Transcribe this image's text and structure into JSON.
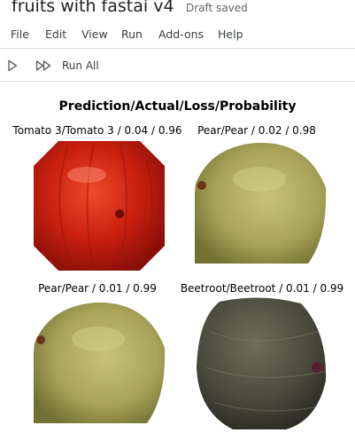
{
  "notebook": {
    "title": "fruits with fastai v4",
    "save_status": "Draft saved"
  },
  "menu": {
    "items": [
      "File",
      "Edit",
      "View",
      "Run",
      "Add-ons",
      "Help"
    ]
  },
  "toolbar": {
    "run_cell_icon": "play-icon",
    "run_all_icon": "fast-forward-icon",
    "run_all_label": "Run All"
  },
  "output": {
    "figure_title": "Prediction/Actual/Loss/Probability",
    "panels": [
      {
        "caption": "Tomato 3/Tomato 3 / 0.04 / 0.96",
        "fruit": "tomato"
      },
      {
        "caption": "Pear/Pear / 0.02 / 0.98",
        "fruit": "pear"
      },
      {
        "caption": "Pear/Pear / 0.01 / 0.99",
        "fruit": "pear"
      },
      {
        "caption": "Beetroot/Beetroot / 0.01 / 0.99",
        "fruit": "beetroot"
      }
    ]
  },
  "colors": {
    "tomato": "#c81d0e",
    "pear": "#a9a65a",
    "beetroot": "#4a4a3e",
    "divider": "#dadce0"
  }
}
